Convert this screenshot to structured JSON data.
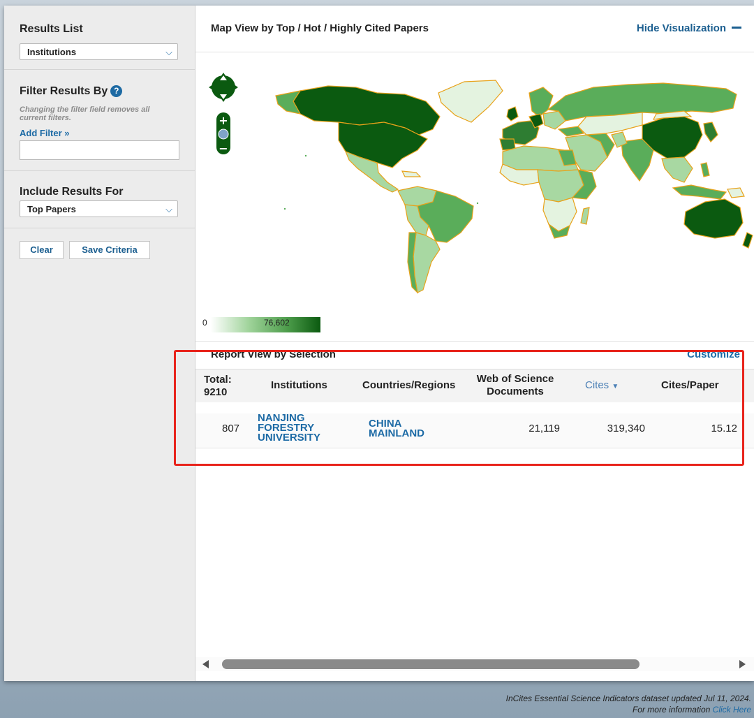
{
  "sidebar": {
    "results_list_title": "Results List",
    "results_list_value": "Institutions",
    "filter_title": "Filter Results By",
    "filter_hint": "Changing the filter field removes all current filters.",
    "add_filter": "Add Filter »",
    "include_title": "Include Results For",
    "include_value": "Top Papers",
    "clear_label": "Clear",
    "save_label": "Save Criteria"
  },
  "map": {
    "title": "Map View by Top / Hot / Highly Cited Papers",
    "hide_label": "Hide Visualization",
    "legend_min": "0",
    "legend_max": "76,602",
    "colors": {
      "darkest": "#0b5a10",
      "dark": "#2e7d32",
      "mid": "#5aad5a",
      "light": "#a8d8a2",
      "lightest": "#e4f3e0",
      "border": "#e8a21a"
    }
  },
  "report": {
    "title": "Report View by Selection",
    "customize": "Customize",
    "headers": {
      "total": "Total:",
      "total_count": "9210",
      "institutions": "Institutions",
      "countries": "Countries/Regions",
      "wos_line1": "Web of Science",
      "wos_line2": "Documents",
      "cites": "Cites",
      "cites_per_paper": "Cites/Paper"
    },
    "rows": [
      {
        "rank": "807",
        "institution_l1": "NANJING",
        "institution_l2": "FORESTRY",
        "institution_l3": "UNIVERSITY",
        "country_l1": "CHINA",
        "country_l2": "MAINLAND",
        "wos_documents": "21,119",
        "cites": "319,340",
        "cites_per_paper": "15.12"
      }
    ]
  },
  "footer": {
    "line1": "InCites Essential Science Indicators dataset updated Jul 11, 2024.",
    "line2_prefix": "For more information ",
    "click_here": "Click Here"
  }
}
